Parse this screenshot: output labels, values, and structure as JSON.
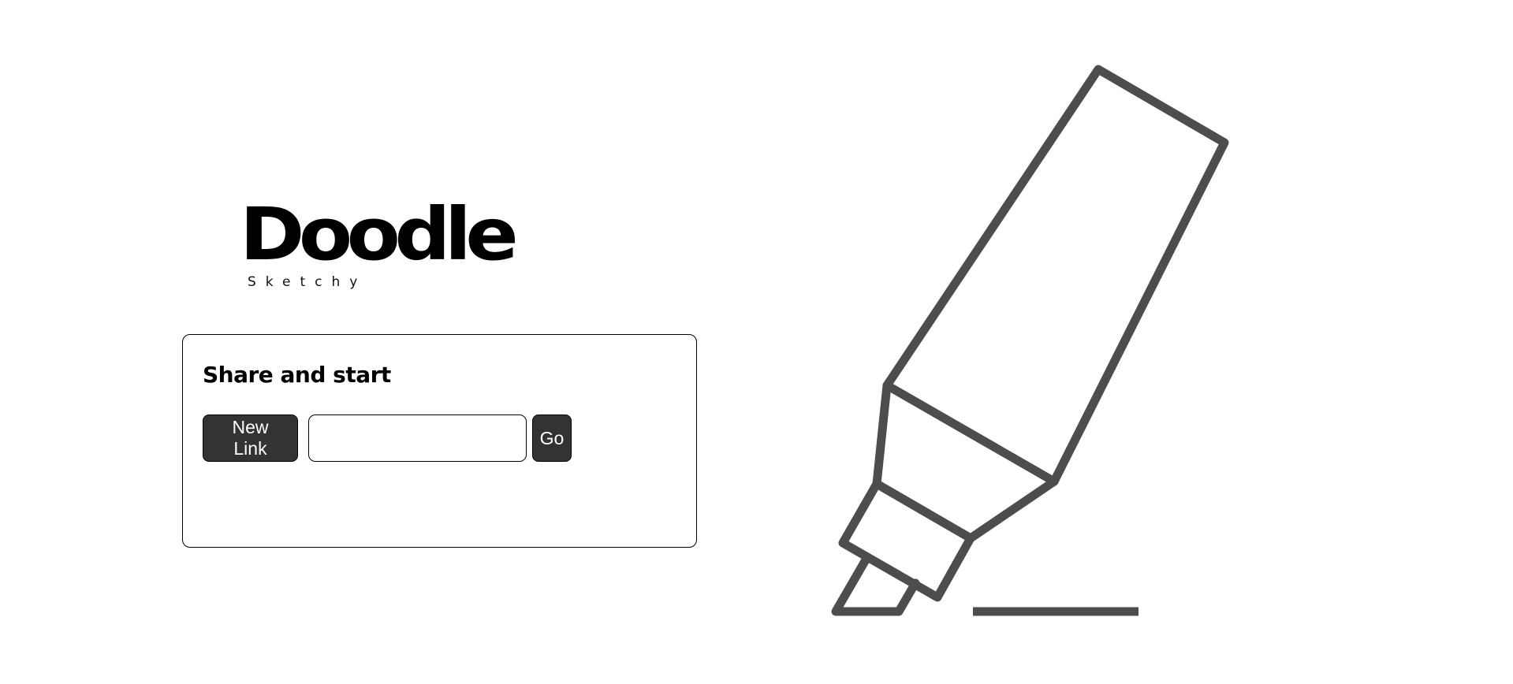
{
  "logo": {
    "title": "Doodle",
    "subtitle": "Sketchy"
  },
  "card": {
    "title": "Share and start",
    "new_link_label": "New Link",
    "link_input_value": "",
    "go_label": "Go"
  },
  "illustration": {
    "icon": "marker-pen-icon",
    "stroke_color": "#4d4d4d"
  },
  "colors": {
    "button_bg": "#333333",
    "button_text": "#ffffff"
  }
}
